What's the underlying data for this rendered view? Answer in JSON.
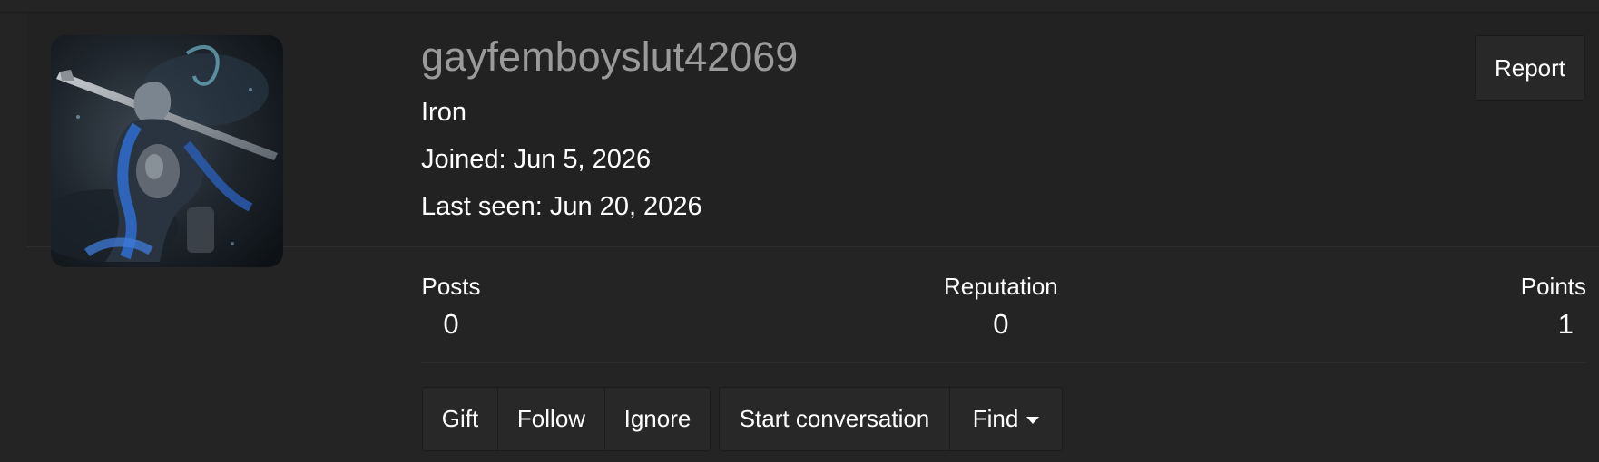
{
  "profile": {
    "username": "gayfemboyslut42069",
    "rank": "Iron",
    "joined": "Joined: Jun 5, 2026",
    "last_seen": "Last seen: Jun 20, 2026",
    "avatar_alt": "knight-with-greatsword-avatar"
  },
  "actions": {
    "report_label": "Report"
  },
  "stats": {
    "posts_label": "Posts",
    "posts_value": "0",
    "reputation_label": "Reputation",
    "reputation_value": "0",
    "points_label": "Points",
    "points_value": "1"
  },
  "buttons": {
    "gift": "Gift",
    "follow": "Follow",
    "ignore": "Ignore",
    "start_conversation": "Start conversation",
    "find": "Find"
  },
  "colors": {
    "background": "#242424",
    "username": "#9a9a9a",
    "text": "#ffffff",
    "button_bg": "#282828"
  }
}
